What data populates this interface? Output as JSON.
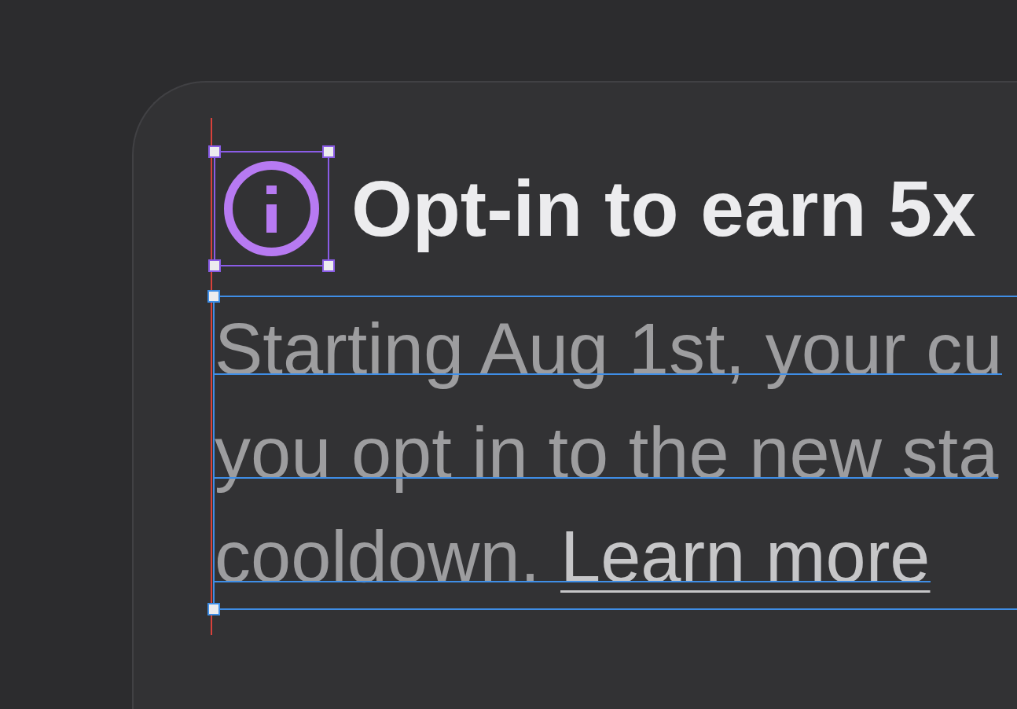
{
  "card": {
    "icon": {
      "selected": true
    },
    "title": "Opt-in to earn 5x",
    "body": {
      "selected": true,
      "lines": [
        "Starting Aug 1st, your cu",
        "you opt in to the new sta",
        "cooldown."
      ],
      "link": "Learn more"
    }
  }
}
